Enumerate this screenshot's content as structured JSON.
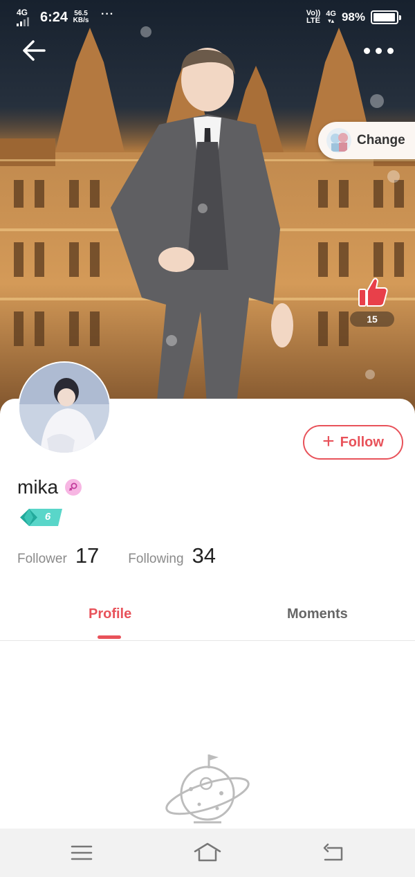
{
  "status_bar": {
    "network": "4G",
    "time": "6:24",
    "speed_value": "56.5",
    "speed_unit": "KB/s",
    "overflow": "···",
    "volte_top": "Vo))",
    "volte_bottom": "LTE",
    "net_right_top": "4G",
    "battery_percent": "98%",
    "battery_level": 0.98
  },
  "header": {
    "back_icon": "arrow-left-icon",
    "more_icon": "more-dots-icon",
    "change_label": "Change"
  },
  "likes": {
    "icon": "thumbs-up-icon",
    "count": "15"
  },
  "profile": {
    "username": "mika",
    "gender_icon": "female-symbol-icon",
    "level": "6",
    "follow_label": "Follow",
    "follower_label": "Follower",
    "follower_count": "17",
    "following_label": "Following",
    "following_count": "34"
  },
  "tabs": [
    {
      "label": "Profile",
      "active": true
    },
    {
      "label": "Moments",
      "active": false
    }
  ],
  "nav_bar": {
    "menu_icon": "menu-icon",
    "home_icon": "home-icon",
    "back_icon": "return-icon"
  },
  "colors": {
    "accent": "#e8525a",
    "level_badge": "#3fc9bb",
    "nav_bg": "#f2f2f2"
  }
}
